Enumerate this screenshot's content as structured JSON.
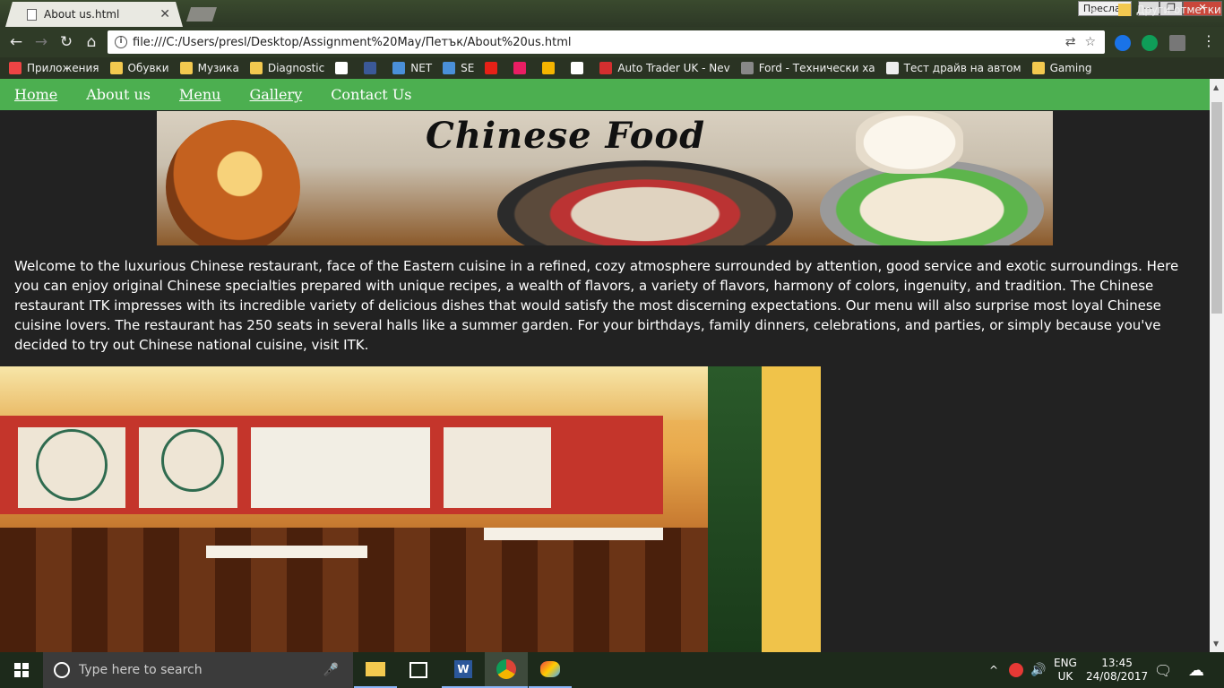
{
  "browser": {
    "tab_title": "About us.html",
    "profile_name": "Преслав",
    "url": "file:///C:/Users/presl/Desktop/Assignment%20May/Петък/About%20us.html",
    "bookmarks": [
      {
        "label": "Приложения",
        "icon": "apps-grid-icon",
        "color": "#e44"
      },
      {
        "label": "Обувки",
        "icon": "folder-icon",
        "color": "#f3c94f"
      },
      {
        "label": "Музика",
        "icon": "folder-icon",
        "color": "#f3c94f"
      },
      {
        "label": "Diagnostic",
        "icon": "folder-icon",
        "color": "#f3c94f"
      },
      {
        "label": "",
        "icon": "google-icon",
        "color": "#fff"
      },
      {
        "label": "",
        "icon": "facebook-icon",
        "color": "#3b5998"
      },
      {
        "label": "NET",
        "icon": "globe-icon",
        "color": "#4a90d9"
      },
      {
        "label": "SE",
        "icon": "globe-icon",
        "color": "#4a90d9"
      },
      {
        "label": "",
        "icon": "youtube-icon",
        "color": "#e62117"
      },
      {
        "label": "",
        "icon": "seven-icon",
        "color": "#e91e63"
      },
      {
        "label": "",
        "icon": "grid-yellow-icon",
        "color": "#f5b400"
      },
      {
        "label": "",
        "icon": "red-cross-icon",
        "color": "#ffffff"
      },
      {
        "label": "Auto Trader UK - Nev",
        "icon": "autotrader-icon",
        "color": "#d32f2f"
      },
      {
        "label": "Ford - Технически ха",
        "icon": "ford-icon",
        "color": "#888"
      },
      {
        "label": "Тест драйв на автом",
        "icon": "page-icon",
        "color": "#eee"
      },
      {
        "label": "Gaming",
        "icon": "folder-icon",
        "color": "#f3c94f"
      }
    ],
    "bookmarks_more": "»",
    "other_bookmarks": "Други отметки"
  },
  "site": {
    "nav": [
      {
        "label": "Home",
        "underline": true
      },
      {
        "label": "About us",
        "underline": false
      },
      {
        "label": "Menu",
        "underline": true
      },
      {
        "label": "Gallery",
        "underline": true
      },
      {
        "label": "Contact Us",
        "underline": false
      }
    ],
    "banner_title": "Chinese Food",
    "intro": "Welcome to the luxurious Chinese restaurant, face of the Eastern cuisine in a refined, cozy atmosphere surrounded by attention, good service and exotic surroundings. Here you can enjoy original Chinese specialties prepared with unique recipes, a wealth of flavors, a variety of flavors, harmony of colors, ingenuity, and tradition. The Chinese restaurant ITK impresses with its incredible variety of delicious dishes that would satisfy the most discerning expectations. Our menu will also surprise most loyal Chinese cuisine lovers. The restaurant has 250 seats in several halls like a summer garden. For your birthdays, family dinners, celebrations, and parties, or simply because you've decided to try out Chinese national cuisine, visit ITK.",
    "nav_color": "#4caf50",
    "page_bg": "#222222"
  },
  "taskbar": {
    "search_placeholder": "Type here to search",
    "lang_line1": "ENG",
    "lang_line2": "UK",
    "time": "13:45",
    "date": "24/08/2017"
  }
}
